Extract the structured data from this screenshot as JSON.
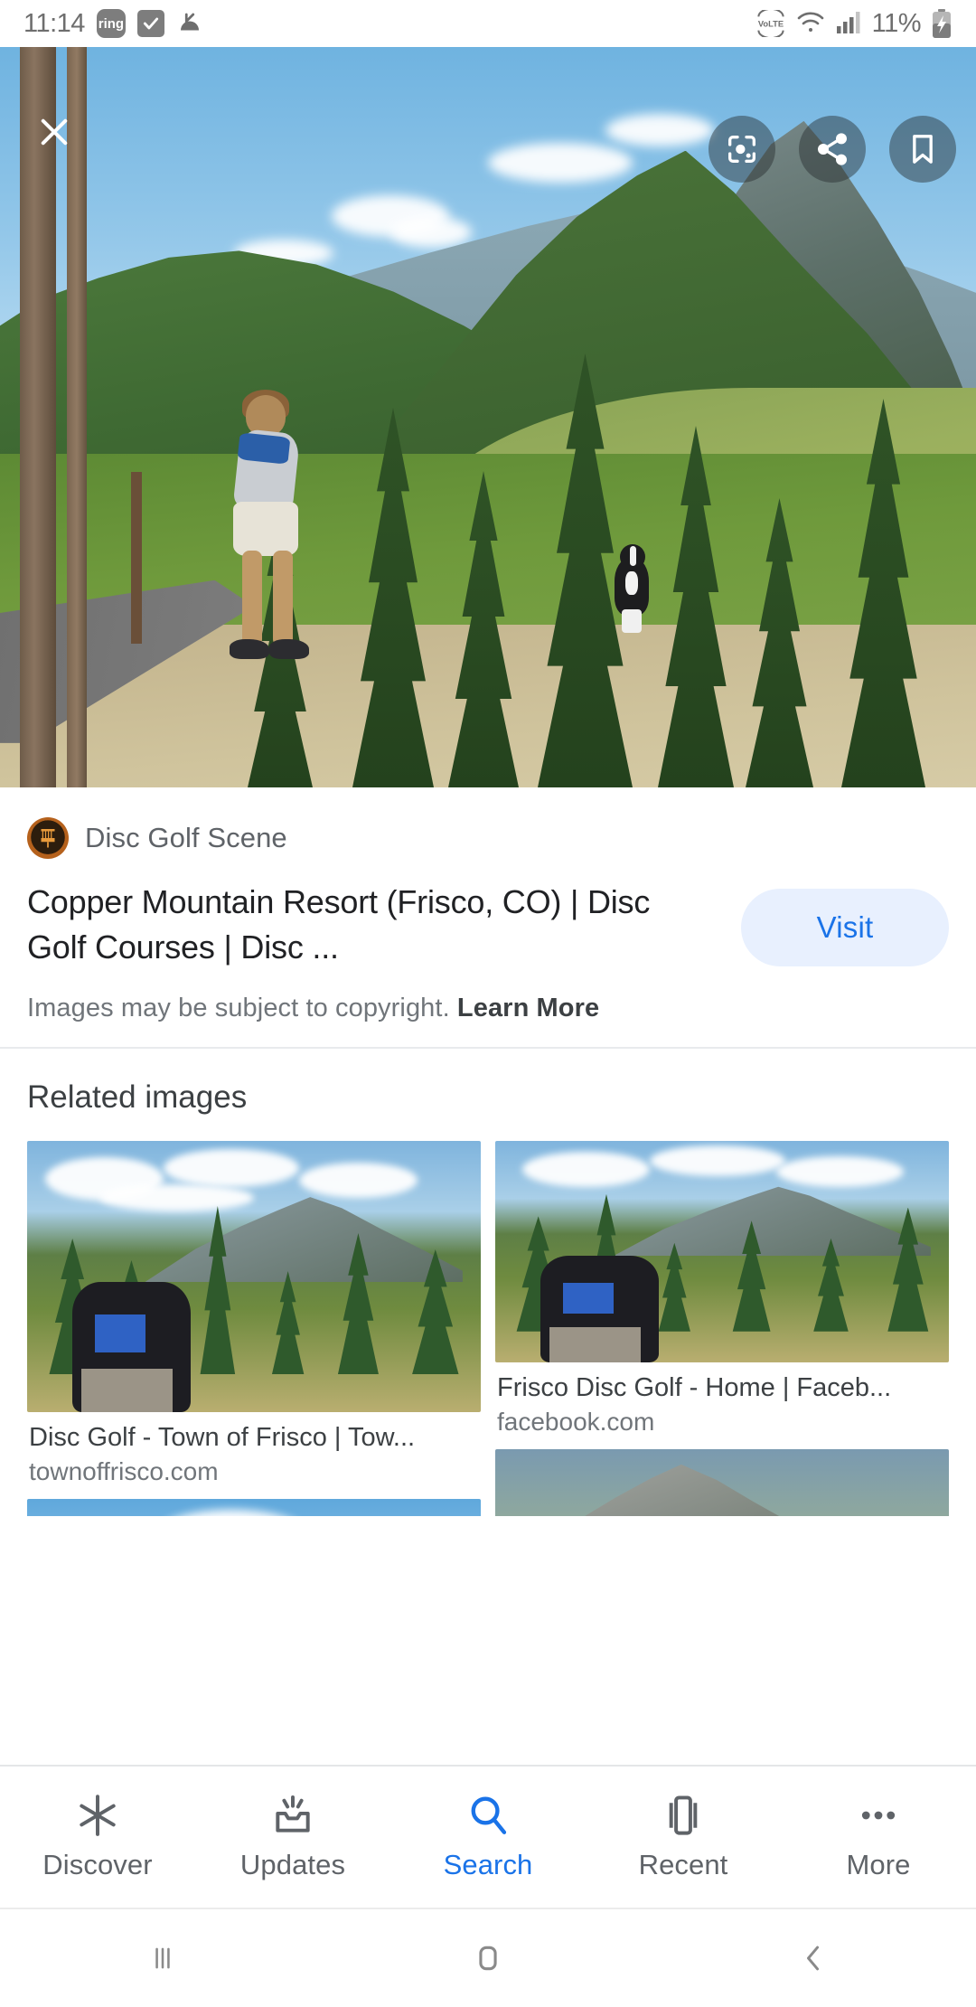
{
  "status_bar": {
    "time": "11:14",
    "ring_badge": "ring",
    "check_icon": "check-badge-icon",
    "headphone_icon": "call-mute-icon",
    "volte": "VoLTE",
    "wifi_icon": "wifi-icon",
    "signal_icon": "cell-signal-icon",
    "battery_percent": "11%",
    "battery_icon": "battery-charging-icon"
  },
  "hero": {
    "close_label": "close-icon",
    "lens_label": "google-lens-icon",
    "share_label": "share-icon",
    "bookmark_label": "bookmark-icon",
    "alt": "Woman throwing a disc from a tee pad at a mountain disc golf course with a black and white dog running on the fairway"
  },
  "result": {
    "source_name": "Disc Golf Scene",
    "favicon": "disc-golf-basket-icon",
    "visit_label": "Visit",
    "title": "Copper Mountain Resort (Frisco, CO) | Disc Golf Courses | Disc ...",
    "copyright_text": "Images may be subject to copyright.",
    "learn_more": "Learn More"
  },
  "related": {
    "heading": "Related images",
    "items": [
      {
        "title": "Disc Golf - Town of Frisco | Tow...",
        "domain": "townoffrisco.com"
      },
      {
        "title": "Frisco Disc Golf - Home | Faceb...",
        "domain": "facebook.com"
      }
    ]
  },
  "bottom_nav": {
    "items": [
      {
        "label": "Discover",
        "icon": "asterisk-icon",
        "active": false
      },
      {
        "label": "Updates",
        "icon": "inbox-updates-icon",
        "active": false
      },
      {
        "label": "Search",
        "icon": "search-icon",
        "active": true
      },
      {
        "label": "Recent",
        "icon": "recent-tabs-icon",
        "active": false
      },
      {
        "label": "More",
        "icon": "more-dots-icon",
        "active": false
      }
    ]
  },
  "system_nav": {
    "recents": "recents-icon",
    "home": "home-icon",
    "back": "back-icon"
  },
  "colors": {
    "accent_blue": "#1a73e8",
    "visit_bg": "#e8f0fe",
    "text_primary": "#202124",
    "text_secondary": "#5f6368",
    "text_muted": "#70757a",
    "divider": "#e8eaed"
  }
}
